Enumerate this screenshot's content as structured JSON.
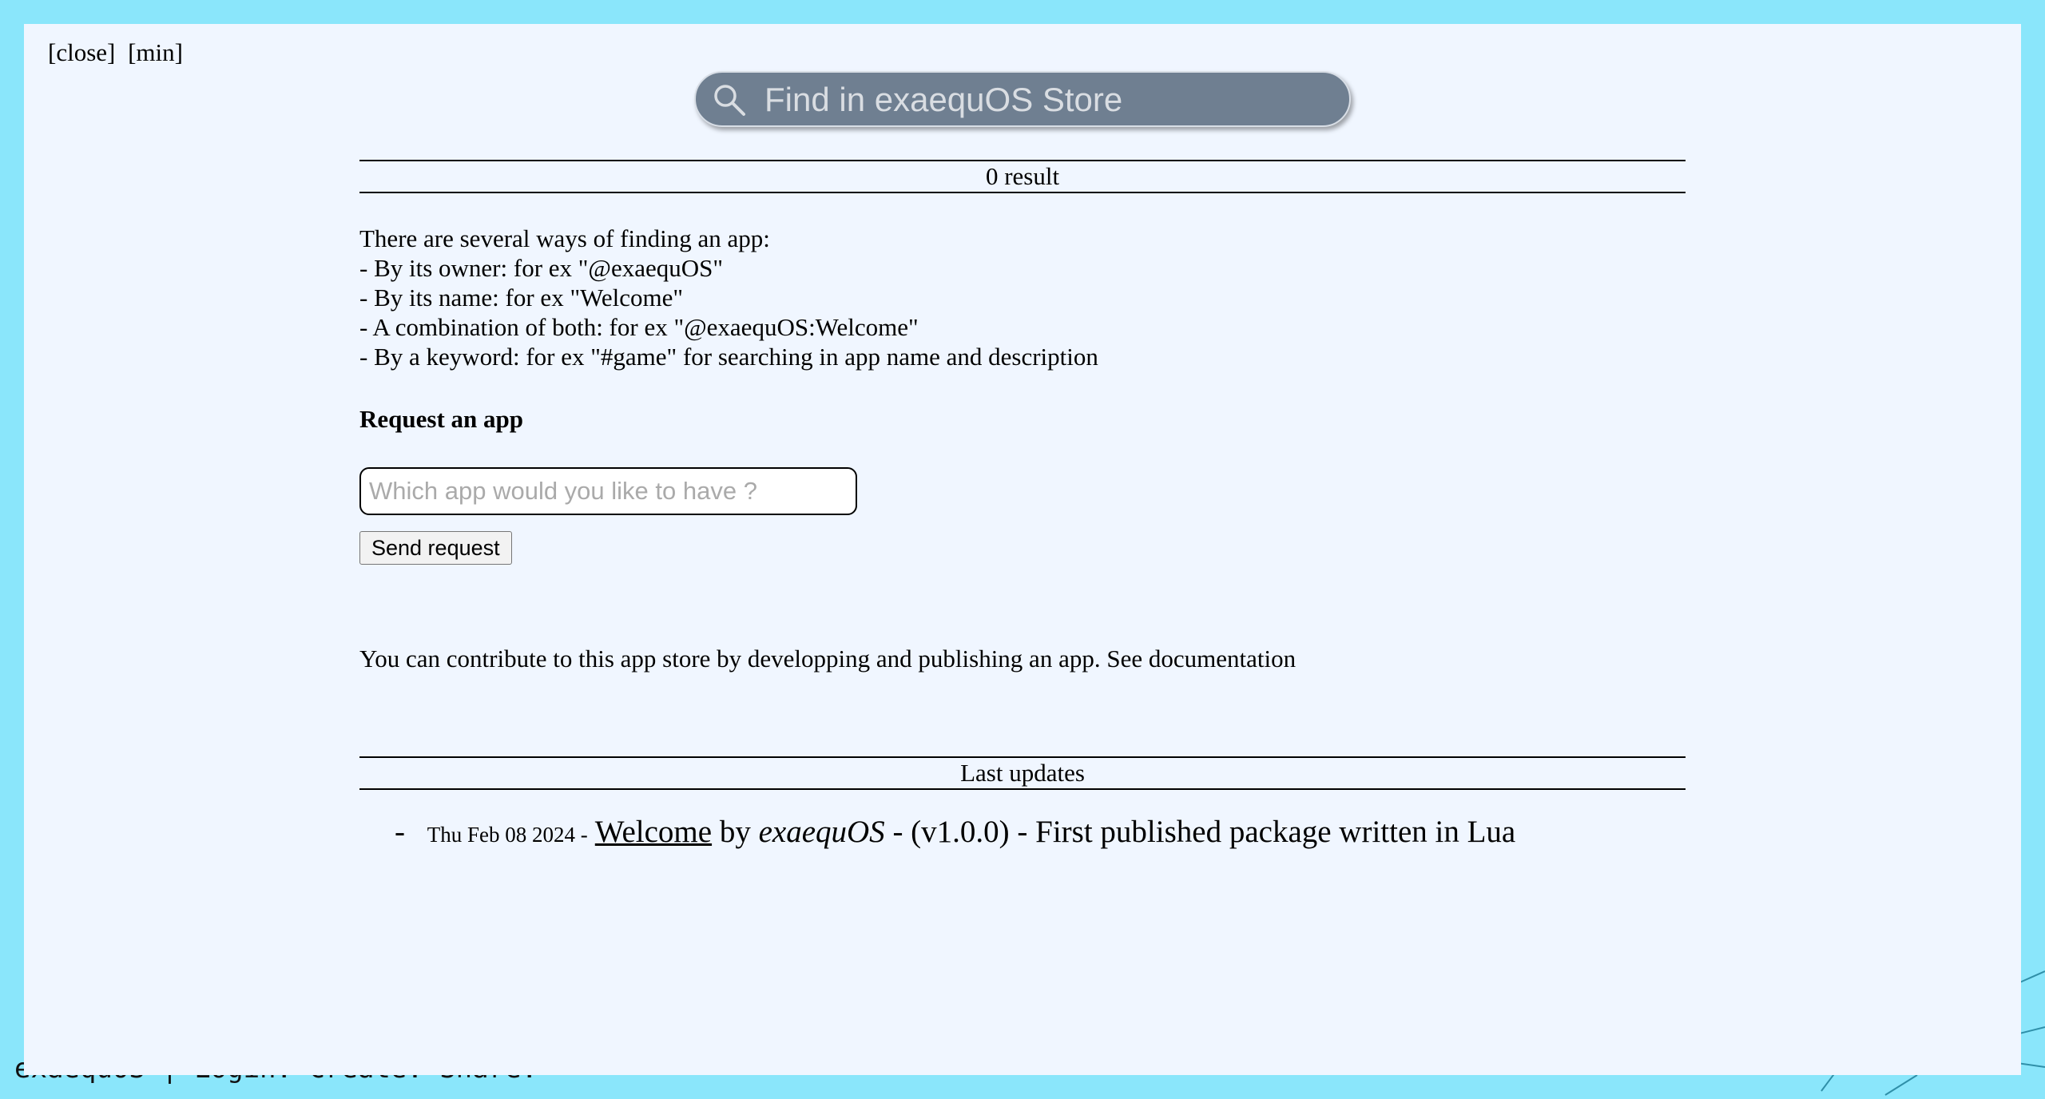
{
  "window": {
    "close_label": "[close]",
    "min_label": "[min]"
  },
  "search": {
    "placeholder": "Find in exaequOS Store",
    "icon": "search-icon"
  },
  "results": {
    "count_label": "0 result"
  },
  "help": {
    "lines": [
      "There are several ways of finding an app:",
      "- By its owner: for ex \"@exaequOS\"",
      "- By its name: for ex \"Welcome\"",
      "- A combination of both: for ex \"@exaequOS:Welcome\"",
      "- By a keyword: for ex \"#game\" for searching in app name and description"
    ]
  },
  "request": {
    "title": "Request an app",
    "placeholder": "Which app would you like to have ?",
    "button_label": "Send request"
  },
  "contribute": {
    "text": "You can contribute to this app store by developping and publishing an app. See documentation"
  },
  "updates": {
    "title": "Last updates",
    "items": [
      {
        "dash": "-",
        "date": "Thu Feb 08 2024 -",
        "app": "Welcome",
        "by": "by",
        "owner": "exaequOS",
        "details": "- (v1.0.0) - First published package written in Lua"
      }
    ]
  },
  "desktop": {
    "taskbar_text": "exaequOS | Login. Create. Share."
  },
  "colors": {
    "desktop_bg": "#8ae6fb",
    "window_bg": "#f0f6ff",
    "search_bg": "#6f7f91"
  }
}
